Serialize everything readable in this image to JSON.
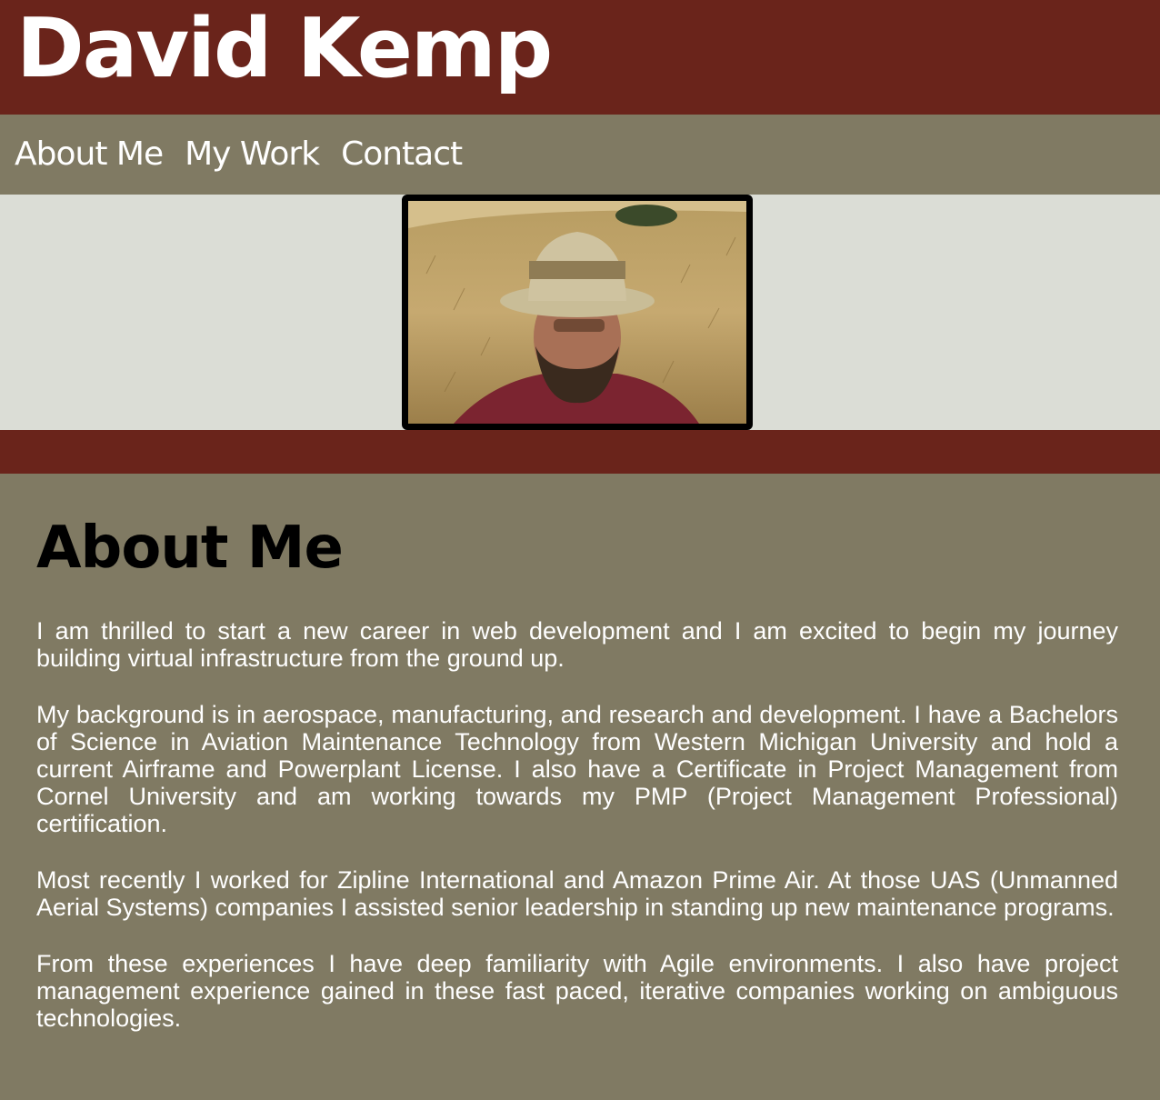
{
  "header": {
    "site_title": "David Kemp"
  },
  "nav": {
    "items": [
      {
        "label": "About Me"
      },
      {
        "label": "My Work"
      },
      {
        "label": "Contact"
      }
    ]
  },
  "colors": {
    "header_bg": "#6a241b",
    "nav_bg": "#807a63",
    "hero_bg": "#dbddd6",
    "text_light": "#ffffff",
    "heading_dark": "#000000"
  },
  "about": {
    "heading": "About Me",
    "paragraphs": [
      "I am thrilled to start a new career in web development and I am excited to begin my journey building virtual infrastructure from the ground up.",
      "My background is in aerospace, manufacturing, and research and development. I have a Bachelors of Science in Aviation Maintenance Technology from Western Michigan University and hold a current Airframe and Powerplant License. I also have a Certificate in Project Management from Cornel University and am working towards my PMP (Project Management Professional) certification.",
      "Most recently I worked for Zipline International and Amazon Prime Air. At those UAS (Unmanned Aerial Systems) companies I assisted senior leadership in standing up new maintenance programs.",
      "From these experiences I have deep familiarity with Agile environments. I also have project management experience gained in these fast paced, iterative companies working on ambiguous technologies."
    ]
  }
}
